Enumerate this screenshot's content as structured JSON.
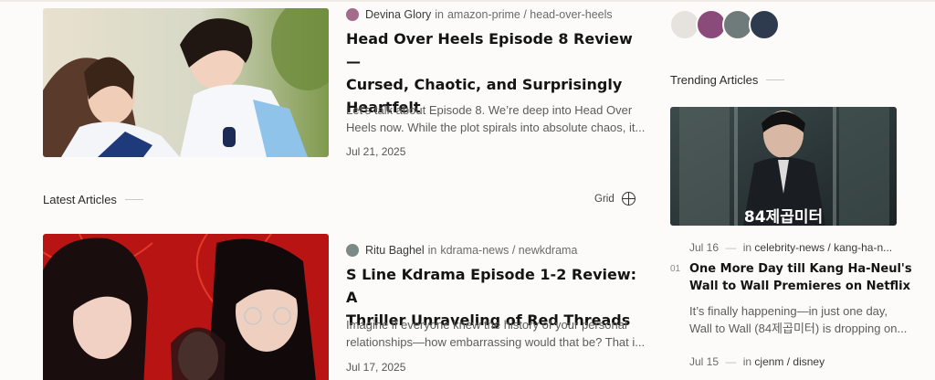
{
  "articles": [
    {
      "author": "Devina Glory",
      "in_word": "in",
      "category": "amazon-prime / head-over-heels",
      "title_lines": [
        "Head Over Heels Episode 8 Review—",
        "Cursed, Chaotic, and Surprisingly",
        "Heartfelt"
      ],
      "excerpt_lines": [
        "Let’s talk about Episode 8. We’re deep into Head Over",
        "Heels now. While the plot spirals into absolute chaos, it..."
      ],
      "date": "Jul 21, 2025"
    },
    {
      "author": "Ritu Baghel",
      "in_word": "in",
      "category": "kdrama-news / newkdrama",
      "title_lines": [
        "S Line Kdrama Episode 1-2 Review: A",
        "Thriller Unraveling of Red Threads"
      ],
      "excerpt_lines": [
        "Imagine if everyone knew the history of your personal",
        "relationships—how embarrassing would that be? That i..."
      ],
      "date": "Jul 17, 2025"
    }
  ],
  "latest": {
    "heading": "Latest Articles",
    "toggle_label": "Grid"
  },
  "sidebar": {
    "heading": "Trending Articles",
    "image_text": "84제곱미터",
    "items": [
      {
        "date": "Jul 16",
        "dash": "—",
        "in_word": "in",
        "category": "celebrity-news / kang-ha-n...",
        "number": "01",
        "title_lines": [
          "One More Day till Kang Ha-Neul's",
          "Wall to Wall Premieres on Netflix"
        ],
        "excerpt_lines": [
          "It’s finally happening—in just one day,",
          "Wall to Wall (84제곱미터) is dropping on..."
        ]
      },
      {
        "date": "Jul 15",
        "dash": "—",
        "in_word": "in",
        "category": "cjenm / disney"
      }
    ]
  },
  "colors": {
    "accent": "#1c1c1c",
    "background": "#fcfbfa",
    "red_poster": "#b81414"
  },
  "icons": [
    "grid-icon"
  ]
}
